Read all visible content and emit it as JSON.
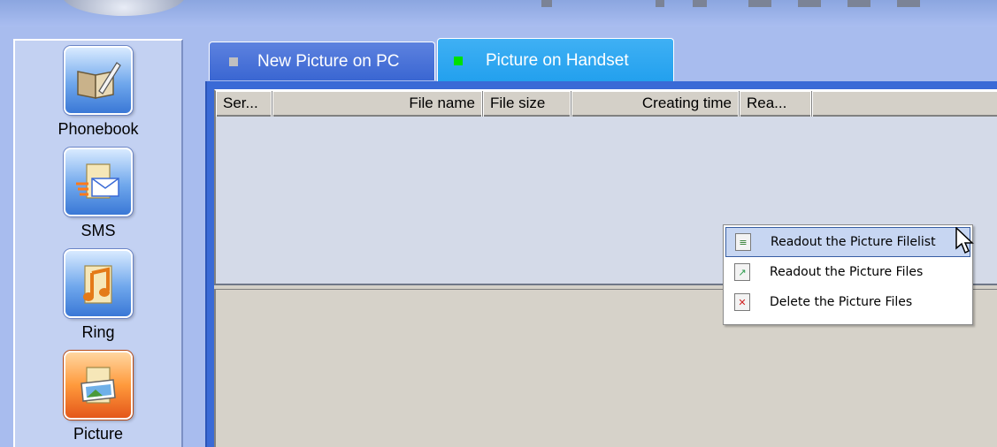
{
  "colors": {
    "tab_inactive_indicator": "#c0c0c0",
    "tab_active_indicator": "#00e000",
    "panel_blue": "#3a6ad6",
    "active_nav": "#ff8a2a"
  },
  "sidebar": {
    "items": [
      {
        "label": "Phonebook",
        "icon": "phonebook-icon",
        "active": false
      },
      {
        "label": "SMS",
        "icon": "sms-envelope-icon",
        "active": false
      },
      {
        "label": "Ring",
        "icon": "music-note-icon",
        "active": false
      },
      {
        "label": "Picture",
        "icon": "picture-icon",
        "active": true
      }
    ]
  },
  "tabs": [
    {
      "label": "New Picture on PC",
      "active": false
    },
    {
      "label": "Picture on Handset",
      "active": true
    }
  ],
  "file_list": {
    "columns": [
      "Ser...",
      "File name",
      "File size",
      "Creating time",
      "Rea..."
    ],
    "rows": []
  },
  "context_menu": {
    "items": [
      {
        "label": "Readout the Picture Filelist",
        "icon": "filelist-icon",
        "hovered": true
      },
      {
        "label": "Readout the Picture Files",
        "icon": "picture-file-icon",
        "hovered": false
      },
      {
        "label": "Delete the Picture Files",
        "icon": "delete-file-icon",
        "hovered": false
      }
    ]
  }
}
